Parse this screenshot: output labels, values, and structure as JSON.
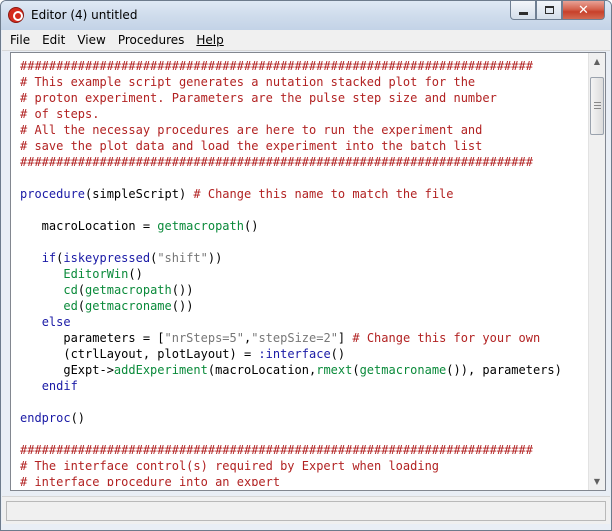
{
  "window": {
    "title": "Editor (4) untitled",
    "minimize_symbol": "",
    "maximize_symbol": "",
    "close_symbol": "✕"
  },
  "menu": {
    "items": [
      {
        "label": "File"
      },
      {
        "label": "Edit"
      },
      {
        "label": "View"
      },
      {
        "label": "Procedures"
      },
      {
        "label": "Help"
      }
    ]
  },
  "code": {
    "lines": [
      [
        {
          "t": "cm",
          "v": "#######################################################################"
        }
      ],
      [
        {
          "t": "cm",
          "v": "# This example script generates a nutation stacked plot for the"
        }
      ],
      [
        {
          "t": "cm",
          "v": "# proton experiment. Parameters are the pulse step size and number"
        }
      ],
      [
        {
          "t": "cm",
          "v": "# of steps."
        }
      ],
      [
        {
          "t": "cm",
          "v": "# All the necessay procedures are here to run the experiment and"
        }
      ],
      [
        {
          "t": "cm",
          "v": "# save the plot data and load the experiment into the batch list"
        }
      ],
      [
        {
          "t": "cm",
          "v": "#######################################################################"
        }
      ],
      [],
      [
        {
          "t": "kw",
          "v": "procedure"
        },
        {
          "t": "tx",
          "v": "(simpleScript) "
        },
        {
          "t": "cm",
          "v": "# Change this name to match the file"
        }
      ],
      [],
      [
        {
          "t": "tx",
          "v": "   macroLocation = "
        },
        {
          "t": "fn",
          "v": "getmacropath"
        },
        {
          "t": "tx",
          "v": "()"
        }
      ],
      [],
      [
        {
          "t": "tx",
          "v": "   "
        },
        {
          "t": "kw",
          "v": "if"
        },
        {
          "t": "tx",
          "v": "("
        },
        {
          "t": "kw",
          "v": "iskeypressed"
        },
        {
          "t": "tx",
          "v": "("
        },
        {
          "t": "st",
          "v": "\"shift\""
        },
        {
          "t": "tx",
          "v": "))"
        }
      ],
      [
        {
          "t": "tx",
          "v": "      "
        },
        {
          "t": "fn",
          "v": "EditorWin"
        },
        {
          "t": "tx",
          "v": "()"
        }
      ],
      [
        {
          "t": "tx",
          "v": "      "
        },
        {
          "t": "fn",
          "v": "cd"
        },
        {
          "t": "tx",
          "v": "("
        },
        {
          "t": "fn",
          "v": "getmacropath"
        },
        {
          "t": "tx",
          "v": "())"
        }
      ],
      [
        {
          "t": "tx",
          "v": "      "
        },
        {
          "t": "fn",
          "v": "ed"
        },
        {
          "t": "tx",
          "v": "("
        },
        {
          "t": "fn",
          "v": "getmacroname"
        },
        {
          "t": "tx",
          "v": "())"
        }
      ],
      [
        {
          "t": "tx",
          "v": "   "
        },
        {
          "t": "kw",
          "v": "else"
        }
      ],
      [
        {
          "t": "tx",
          "v": "      parameters = ["
        },
        {
          "t": "st",
          "v": "\"nrSteps=5\""
        },
        {
          "t": "tx",
          "v": ","
        },
        {
          "t": "st",
          "v": "\"stepSize=2\""
        },
        {
          "t": "tx",
          "v": "] "
        },
        {
          "t": "cm",
          "v": "# Change this for your own"
        }
      ],
      [
        {
          "t": "tx",
          "v": "      (ctrlLayout, plotLayout) = "
        },
        {
          "t": "sy",
          "v": ":interface"
        },
        {
          "t": "tx",
          "v": "()"
        }
      ],
      [
        {
          "t": "tx",
          "v": "      gExpt->"
        },
        {
          "t": "fn",
          "v": "addExperiment"
        },
        {
          "t": "tx",
          "v": "(macroLocation,"
        },
        {
          "t": "fn",
          "v": "rmext"
        },
        {
          "t": "tx",
          "v": "("
        },
        {
          "t": "fn",
          "v": "getmacroname"
        },
        {
          "t": "tx",
          "v": "()), parameters)"
        }
      ],
      [
        {
          "t": "tx",
          "v": "   "
        },
        {
          "t": "kw",
          "v": "endif"
        }
      ],
      [],
      [
        {
          "t": "kw",
          "v": "endproc"
        },
        {
          "t": "tx",
          "v": "()"
        }
      ],
      [],
      [
        {
          "t": "cm",
          "v": "#######################################################################"
        }
      ],
      [
        {
          "t": "cm",
          "v": "# The interface control(s) required by Expert when loading"
        }
      ],
      [
        {
          "t": "cm",
          "v": "# interface procedure into an expert"
        }
      ]
    ]
  },
  "statusbar": {
    "text": ""
  }
}
